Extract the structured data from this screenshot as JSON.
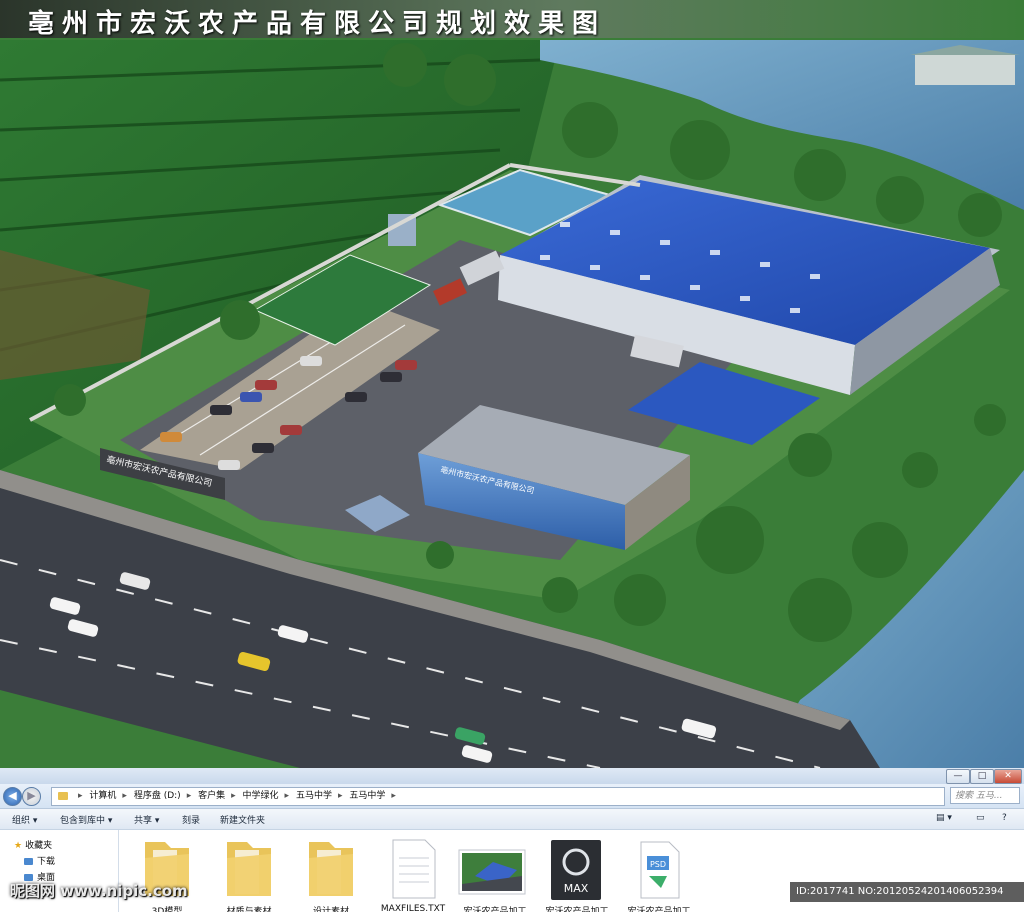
{
  "render": {
    "title": "亳州市宏沃农产品有限公司规划效果图",
    "company_sign": "亳州市宏沃农产品有限公司",
    "office_sign": "亳州市宏沃农产品有限公司"
  },
  "window": {
    "controls": {
      "minimize": "—",
      "maximize": "□",
      "close": "✕"
    }
  },
  "address_bar": {
    "crumbs": [
      "计算机",
      "程序盘 (D:)",
      "客户集",
      "中学绿化",
      "五马中学",
      "五马中学"
    ],
    "search_placeholder": "搜索 五马..."
  },
  "toolbar": {
    "organize": "组织 ▾",
    "include_in_library": "包含到库中 ▾",
    "share": "共享 ▾",
    "burn": "刻录",
    "new_folder": "新建文件夹"
  },
  "nav_pane": {
    "items": [
      "收藏夹",
      "下载",
      "桌面"
    ]
  },
  "files": [
    {
      "name": "3D模型",
      "type": "folder"
    },
    {
      "name": "材质与素材",
      "type": "folder"
    },
    {
      "name": "设计素材",
      "type": "folder"
    },
    {
      "name": "MAXFILES.TXT",
      "type": "text"
    },
    {
      "name": "宏沃农产品加工",
      "type": "image"
    },
    {
      "name": "宏沃农产品加工",
      "type": "max",
      "badge": "MAX"
    },
    {
      "name": "宏沃农产品加工",
      "type": "psd",
      "badge": "PSD"
    }
  ],
  "watermark": {
    "site": "昵图网 www.nipic.com",
    "id": "ID:2017741 NO:20120524201406052394"
  },
  "colors": {
    "roof_blue": "#2f5fc8",
    "grass": "#3f8a3a",
    "water": "#5d8fb4",
    "road": "#3c4048"
  }
}
